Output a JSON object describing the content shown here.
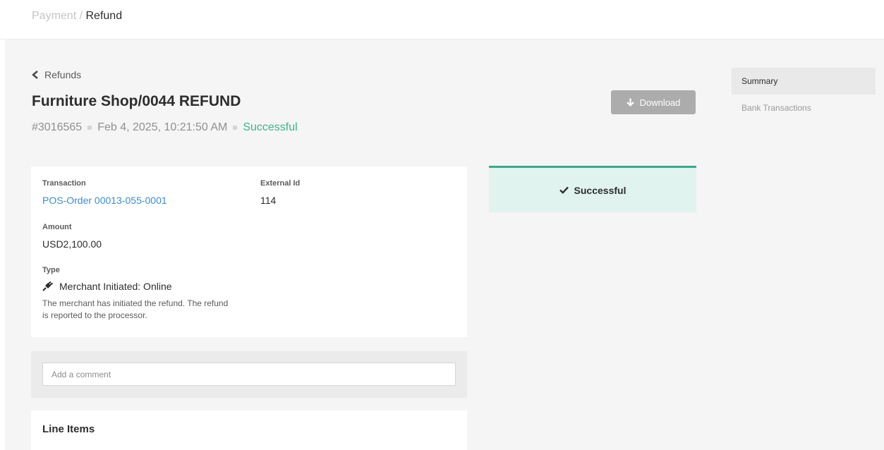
{
  "breadcrumb": {
    "parent": "Payment",
    "separator": "/",
    "current": "Refund"
  },
  "back_link": {
    "label": "Refunds"
  },
  "header": {
    "title": "Furniture Shop/0044 REFUND",
    "id": "#3016565",
    "datetime": "Feb 4, 2025, 10:21:50 AM",
    "status": "Successful"
  },
  "download_button": {
    "label": "Download"
  },
  "side_nav": {
    "items": [
      {
        "label": "Summary"
      },
      {
        "label": "Bank Transactions"
      }
    ]
  },
  "details": {
    "transaction_label": "Transaction",
    "transaction_value": "POS-Order 00013-055-0001",
    "external_id_label": "External Id",
    "external_id_value": "114",
    "amount_label": "Amount",
    "amount_value": "USD2,100.00",
    "type_label": "Type",
    "type_value": "Merchant Initiated: Online",
    "type_description": "The merchant has initiated the refund. The refund is reported to the processor."
  },
  "status_panel": {
    "label": "Successful"
  },
  "comment": {
    "placeholder": "Add a comment"
  },
  "line_items": {
    "title": "Line Items"
  },
  "colors": {
    "success": "#3bb58a",
    "link": "#3a8ed6",
    "status_bg": "#e0f3ee",
    "button_bg": "#acacac"
  },
  "icons": {
    "back": "chevron-left-icon",
    "download": "arrow-down-icon",
    "type": "plug-icon",
    "status": "check-icon"
  }
}
